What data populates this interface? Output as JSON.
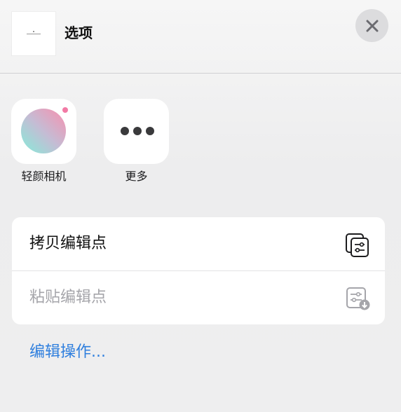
{
  "header": {
    "title": "选项",
    "thumbnail_icon": "document-thumbnail",
    "close_icon": "close-icon"
  },
  "apps": [
    {
      "label": "轻颜相机",
      "icon": "qingyan-camera-app-icon"
    },
    {
      "label": "更多",
      "icon": "more-icon"
    }
  ],
  "actions": [
    {
      "label": "拷贝编辑点",
      "icon": "copy-edits-icon",
      "enabled": true
    },
    {
      "label": "粘贴编辑点",
      "icon": "paste-edits-icon",
      "enabled": false
    }
  ],
  "edit_actions_link": "编辑操作...",
  "colors": {
    "link": "#2f7fde",
    "disabled_text": "#a5a5aa",
    "close_button_bg": "#dcdcde"
  }
}
